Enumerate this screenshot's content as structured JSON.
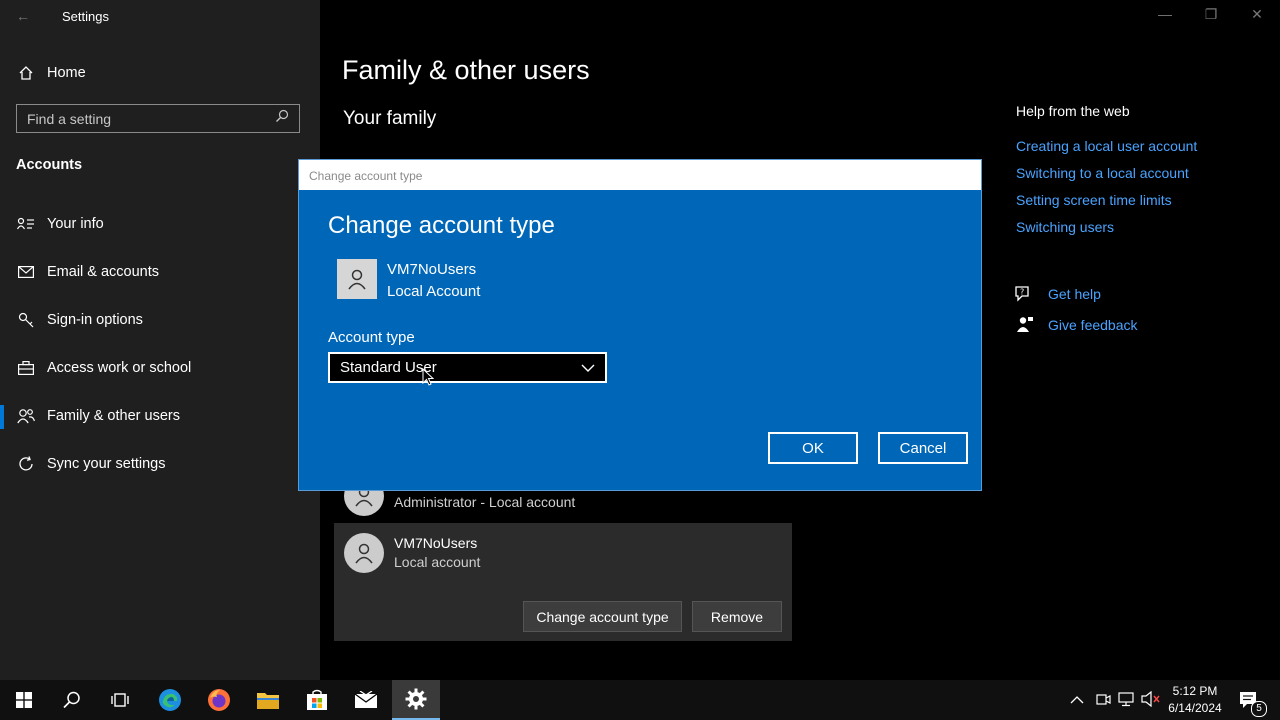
{
  "window": {
    "title": "Settings"
  },
  "sidebar": {
    "home_label": "Home",
    "search_placeholder": "Find a setting",
    "section_title": "Accounts",
    "items": [
      {
        "label": "Your info",
        "icon": "person-lines-icon"
      },
      {
        "label": "Email & accounts",
        "icon": "mail-icon"
      },
      {
        "label": "Sign-in options",
        "icon": "key-icon"
      },
      {
        "label": "Access work or school",
        "icon": "briefcase-icon"
      },
      {
        "label": "Family & other users",
        "icon": "people-icon",
        "selected": true
      },
      {
        "label": "Sync your settings",
        "icon": "sync-icon"
      }
    ]
  },
  "main": {
    "title": "Family & other users",
    "subtitle": "Your family",
    "other_users": [
      {
        "role": "Administrator - Local account"
      },
      {
        "name": "VM7NoUsers",
        "role": "Local account"
      }
    ],
    "change_button": "Change account type",
    "remove_button": "Remove"
  },
  "help": {
    "title": "Help from the web",
    "links": [
      "Creating a local user account",
      "Switching to a local account",
      "Setting screen time limits",
      "Switching users"
    ],
    "get_help": "Get help",
    "give_feedback": "Give feedback"
  },
  "dialog": {
    "window_title": "Change account type",
    "heading": "Change account type",
    "user_name": "VM7NoUsers",
    "user_type": "Local Account",
    "account_type_label": "Account type",
    "account_type_value": "Standard User",
    "ok": "OK",
    "cancel": "Cancel"
  },
  "taskbar": {
    "time": "5:12 PM",
    "date": "6/14/2024",
    "notification_count": "5",
    "apps": [
      "start-icon",
      "search-icon",
      "task-view-icon",
      "edge-icon",
      "firefox-icon",
      "file-explorer-icon",
      "store-icon",
      "mail-icon",
      "settings-icon"
    ]
  },
  "colors": {
    "accent": "#0067b8",
    "link": "#4aa3ff",
    "selected_bar": "#0078d7"
  }
}
